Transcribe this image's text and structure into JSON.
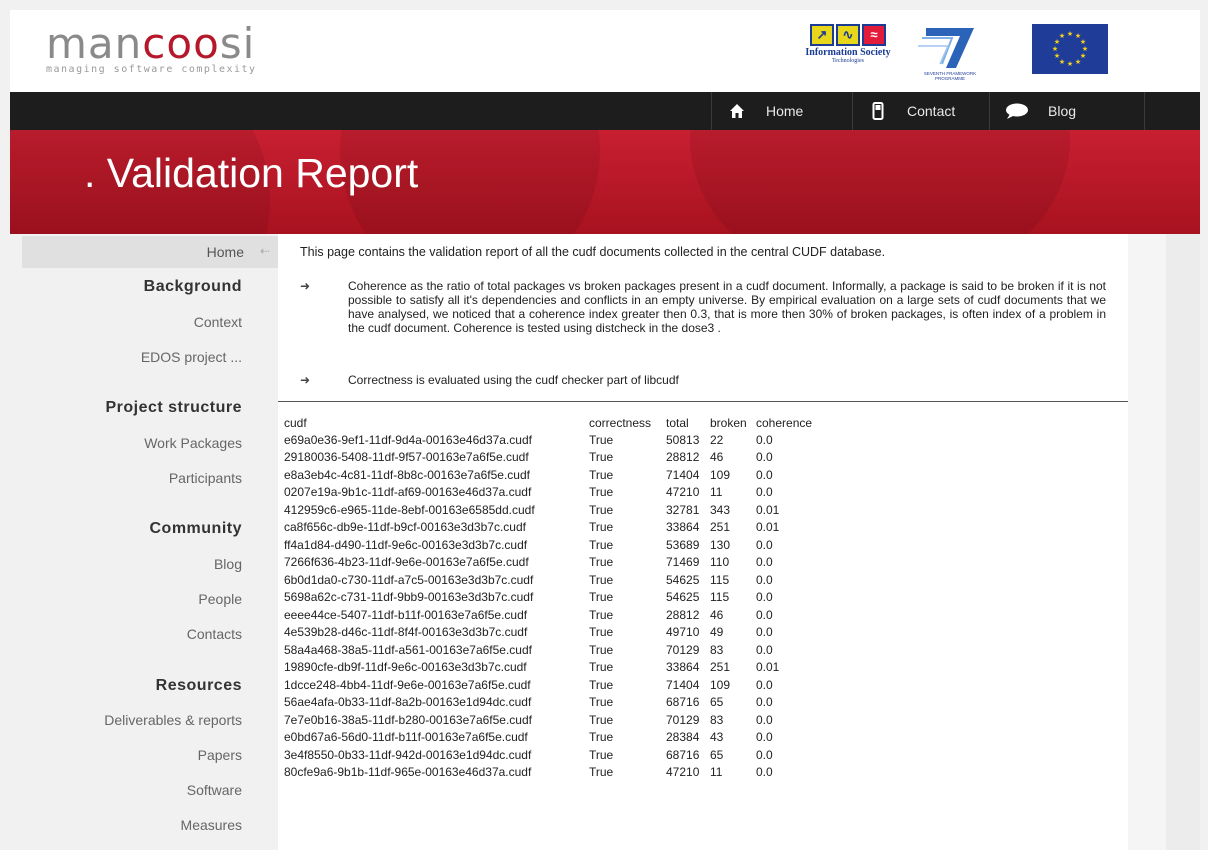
{
  "header": {
    "logo_pre": "man",
    "logo_accent": "coo",
    "logo_post": "si",
    "logo_tagline": "managing software complexity",
    "partner_is_title": "Information Society",
    "partner_is_sub": "Technologies",
    "partner_fp7_line1": "SEVENTH FRAMEWORK",
    "partner_fp7_line2": "PROGRAMME"
  },
  "nav": {
    "items": [
      {
        "label": "Home",
        "icon": "home-icon"
      },
      {
        "label": "Contact",
        "icon": "phone-icon"
      },
      {
        "label": "Blog",
        "icon": "speech-bubble-icon"
      }
    ]
  },
  "banner": {
    "title": ". Validation Report"
  },
  "sidebar": {
    "home": "Home",
    "sections": [
      {
        "heading": "Background",
        "links": [
          "Context",
          "EDOS project ..."
        ]
      },
      {
        "heading": "Project structure",
        "links": [
          "Work Packages",
          "Participants"
        ]
      },
      {
        "heading": "Community",
        "links": [
          "Blog",
          "People",
          "Contacts"
        ]
      },
      {
        "heading": "Resources",
        "links": [
          "Deliverables & reports",
          "Papers",
          "Software",
          "Measures"
        ]
      }
    ]
  },
  "content": {
    "intro": "This page contains the validation report of all the cudf documents collected in the central CUDF database.",
    "bullets": [
      "Coherence as the ratio of total packages vs broken packages present in a cudf document. Informally, a package is said to be broken if it is not possible to satisfy all it's dependencies and conflicts in an empty universe. By empirical evaluation on a large sets of cudf documents that we have analysed, we noticed that a coherence index greater then 0.3, that is more then 30% of broken packages, is often index of a problem in the cudf document. Coherence is tested using distcheck in the dose3 .",
      "Correctness is evaluated using the cudf checker part of libcudf"
    ],
    "table": {
      "headers": [
        "cudf",
        "correctness",
        "total",
        "broken",
        "coherence"
      ],
      "rows": [
        [
          "e69a0e36-9ef1-11df-9d4a-00163e46d37a.cudf",
          "True",
          "50813",
          "22",
          "0.0"
        ],
        [
          "29180036-5408-11df-9f57-00163e7a6f5e.cudf",
          "True",
          "28812",
          "46",
          "0.0"
        ],
        [
          "e8a3eb4c-4c81-11df-8b8c-00163e7a6f5e.cudf",
          "True",
          "71404",
          "109",
          "0.0"
        ],
        [
          "0207e19a-9b1c-11df-af69-00163e46d37a.cudf",
          "True",
          "47210",
          "11",
          "0.0"
        ],
        [
          "412959c6-e965-11de-8ebf-00163e6585dd.cudf",
          "True",
          "32781",
          "343",
          "0.01"
        ],
        [
          "ca8f656c-db9e-11df-b9cf-00163e3d3b7c.cudf",
          "True",
          "33864",
          "251",
          "0.01"
        ],
        [
          "ff4a1d84-d490-11df-9e6c-00163e3d3b7c.cudf",
          "True",
          "53689",
          "130",
          "0.0"
        ],
        [
          "7266f636-4b23-11df-9e6e-00163e7a6f5e.cudf",
          "True",
          "71469",
          "110",
          "0.0"
        ],
        [
          "6b0d1da0-c730-11df-a7c5-00163e3d3b7c.cudf",
          "True",
          "54625",
          "115",
          "0.0"
        ],
        [
          "5698a62c-c731-11df-9bb9-00163e3d3b7c.cudf",
          "True",
          "54625",
          "115",
          "0.0"
        ],
        [
          "eeee44ce-5407-11df-b11f-00163e7a6f5e.cudf",
          "True",
          "28812",
          "46",
          "0.0"
        ],
        [
          "4e539b28-d46c-11df-8f4f-00163e3d3b7c.cudf",
          "True",
          "49710",
          "49",
          "0.0"
        ],
        [
          "58a4a468-38a5-11df-a561-00163e7a6f5e.cudf",
          "True",
          "70129",
          "83",
          "0.0"
        ],
        [
          "19890cfe-db9f-11df-9e6c-00163e3d3b7c.cudf",
          "True",
          "33864",
          "251",
          "0.01"
        ],
        [
          "1dcce248-4bb4-11df-9e6e-00163e7a6f5e.cudf",
          "True",
          "71404",
          "109",
          "0.0"
        ],
        [
          "56ae4afa-0b33-11df-8a2b-00163e1d94dc.cudf",
          "True",
          "68716",
          "65",
          "0.0"
        ],
        [
          "7e7e0b16-38a5-11df-b280-00163e7a6f5e.cudf",
          "True",
          "70129",
          "83",
          "0.0"
        ],
        [
          "e0bd67a6-56d0-11df-b11f-00163e7a6f5e.cudf",
          "True",
          "28384",
          "43",
          "0.0"
        ],
        [
          "3e4f8550-0b33-11df-942d-00163e1d94dc.cudf",
          "True",
          "68716",
          "65",
          "0.0"
        ],
        [
          "80cfe9a6-9b1b-11df-965e-00163e46d37a.cudf",
          "True",
          "47210",
          "11",
          "0.0"
        ]
      ]
    }
  }
}
